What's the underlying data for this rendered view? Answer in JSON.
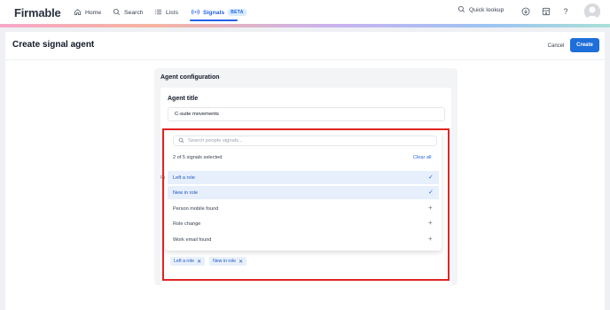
{
  "nav": {
    "logo": "Firmable",
    "items": [
      {
        "label": "Home",
        "icon": "home-icon"
      },
      {
        "label": "Search",
        "icon": "search-icon"
      },
      {
        "label": "Lists",
        "icon": "list-icon"
      },
      {
        "label": "Signals",
        "icon": "signals-icon",
        "badge": "BETA",
        "active": true
      }
    ],
    "quick_lookup": "Quick lookup",
    "icons": [
      "download-icon",
      "export-icon",
      "help-icon",
      "avatar"
    ]
  },
  "page": {
    "title": "Create signal agent",
    "cancel_label": "Cancel",
    "create_label": "Create"
  },
  "config": {
    "section_title": "Agent configuration",
    "agent_title_label": "Agent title",
    "agent_title_value": "C-suite movements",
    "hidden_label_fragment": "Pe"
  },
  "signals_dropdown": {
    "search_placeholder": "Search people signals...",
    "selected_count": "2 of 5 signals selected",
    "clear_all": "Clear all",
    "options": [
      {
        "label": "Left a role",
        "selected": true
      },
      {
        "label": "New in role",
        "selected": true
      },
      {
        "label": "Person mobile found",
        "selected": false
      },
      {
        "label": "Role change",
        "selected": false
      },
      {
        "label": "Work email found",
        "selected": false
      }
    ]
  },
  "chips": [
    {
      "label": "Left a role"
    },
    {
      "label": "New in role"
    }
  ],
  "colors": {
    "accent": "#2563eb",
    "primary_button": "#1e6fd9",
    "highlight": "#e02424"
  }
}
